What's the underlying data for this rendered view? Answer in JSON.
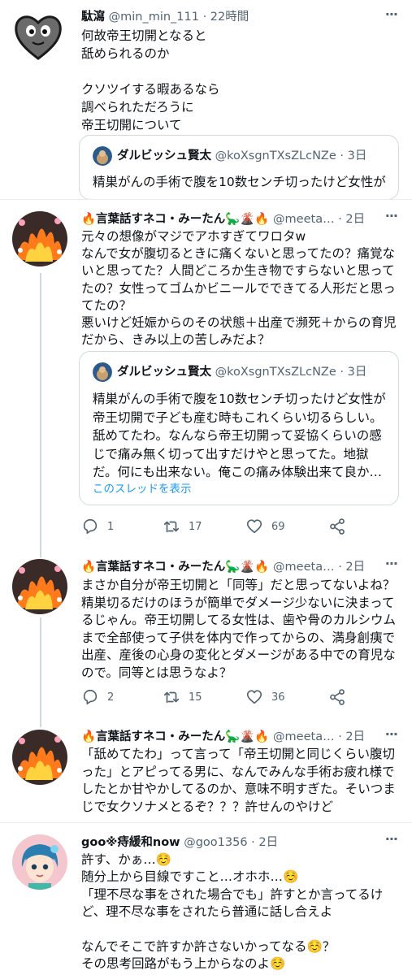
{
  "tweets": [
    {
      "name": "駄瀉",
      "handle": "@min_min_111",
      "time": "· 22時間",
      "text": "何故帝王切開となると\n舐められるのか\n\nクソツイする暇あるなら\n調べられただろうに\n帝王切開について",
      "quote": {
        "name": "ダルビッシュ賢太",
        "handle": "@koXsgnTXsZLcNZe",
        "time": "· 3日",
        "text": "精巣がんの手術で腹を10数センチ切ったけど女性が"
      }
    },
    {
      "name": "🔥言葉話すネコ・みーたん🦕🌋🔥",
      "handle": "@meeta…",
      "time": "· 2日",
      "text": "元々の想像がマジでアホすぎてワロタw\nなんで女が腹切るときに痛くないと思ってたの？痛覚ないと思ってた？人間どころか生き物ですらないと思ってたの？女性ってゴムかビニールでできてる人形だと思ってたの？\n悪いけど妊娠からのその状態＋出産で瀕死＋からの育児だから、きみ以上の苦しみだよ？",
      "quote": {
        "name": "ダルビッシュ賢太",
        "handle": "@koXsgnTXsZLcNZe",
        "time": "· 3日",
        "text": "精巣がんの手術で腹を10数センチ切ったけど女性が帝王切開で子ども産む時もこれくらい切るらしい。舐めてたわ。なんなら帝王切開って妥協くらいの感じで痛み無く切って出すだけやと思ってた。地獄だ。何にも出来ない。俺この痛み体験出来て良か…",
        "link": "このスレッドを表示"
      },
      "replies": "1",
      "retweets": "17",
      "likes": "69"
    },
    {
      "name": "🔥言葉話すネコ・みーたん🦕🌋🔥",
      "handle": "@meeta…",
      "time": "· 2日",
      "text": "まさか自分が帝王切開と「同等」だと思ってないよね？精巣切るだけのほうが簡単でダメージ少ないに決まってるじゃん。帝王切開してる女性は、歯や骨のカルシウムまで全部使って子供を体内で作ってからの、満身創痍で出産、産後の心身の変化とダメージがある中での育児なので。同等とは思うなよ？",
      "replies": "2",
      "retweets": "15",
      "likes": "36"
    },
    {
      "name": "🔥言葉話すネコ・みーたん🦕🌋🔥",
      "handle": "@meeta…",
      "time": "· 2日",
      "text": "「舐めてたわ」って言って「帝王切開と同じくらい腹切った」とアピってる男に、なんでみんな手術お疲れ様でしたとか甘やかしてるのか、意味不明すぎた。そいつまじで女クソナメとるぞ？？？許せんのやけど"
    },
    {
      "name": "goo※痔緩和now",
      "handle": "@goo1356",
      "time": "· 2日",
      "text": "許す、かぁ…☺️\n随分上から目線ですこと…オホホ…☺️\n「理不尽な事をされた場合でも」許すとか言ってるけど、理不尽な事をされたら普通に話し合えよ\n\nなんでそこで許すか許さないかってなる☺️？\nその思考回路がもう上からなのよ☺️"
    }
  ],
  "colors": {
    "text": "#0f1419",
    "secondary": "#536471",
    "link": "#1d9bf0",
    "border": "#cfd9de"
  },
  "icons": [
    "more-icon",
    "reply-icon",
    "retweet-icon",
    "like-icon",
    "share-icon"
  ]
}
